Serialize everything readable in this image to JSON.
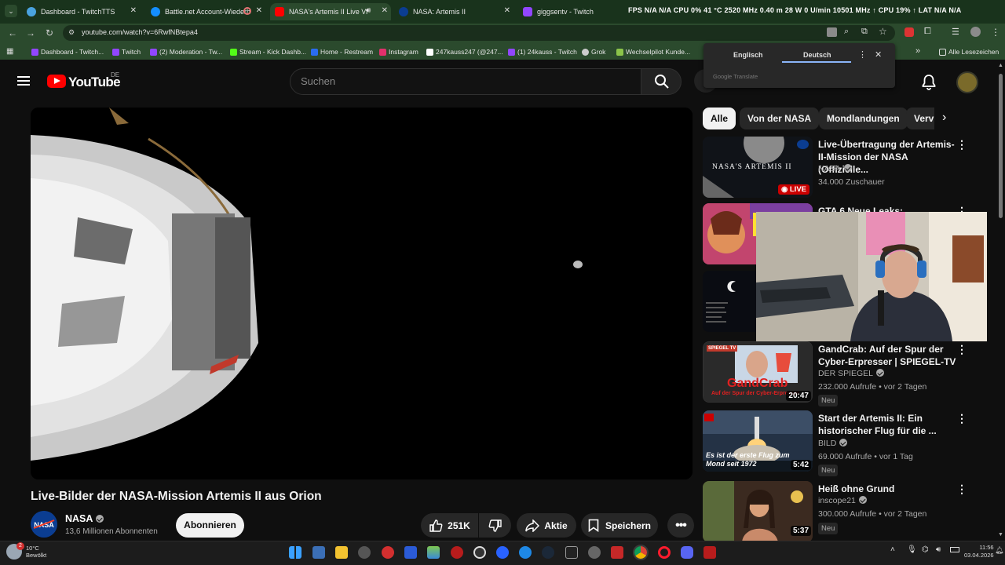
{
  "browser": {
    "tabs": [
      {
        "title": "Dashboard - TwitchTTS",
        "active": false,
        "icon": "globe-icon"
      },
      {
        "title": "Battle.net Account-Wiederh",
        "active": false,
        "icon": "battlenet-icon"
      },
      {
        "title": "NASA's Artemis II Live View",
        "active": true,
        "icon": "youtube-icon"
      },
      {
        "title": "NASA: Artemis II",
        "active": false,
        "icon": "nasa-icon"
      },
      {
        "title": "giggsentv - Twitch",
        "active": false,
        "icon": "twitch-icon"
      }
    ],
    "overlay_stats": "FPS N/A N/A CPU 0% 41 °C 2520 MHz 0.40 m 28 W 0 U/min 10501 MHz ↑ CPU 19% ↑ LAT N/A N/A",
    "url": "youtube.com/watch?v=6RwfNBtepa4",
    "bookmarks": [
      {
        "label": "Dashboard - Twitch...",
        "color": "#9146ff"
      },
      {
        "label": "Twitch",
        "color": "#9146ff"
      },
      {
        "label": "(2) Moderation - Tw...",
        "color": "#9146ff"
      },
      {
        "label": "Stream - Kick Dashb...",
        "color": "#53fc18"
      },
      {
        "label": "Home - Restream",
        "color": "#2a6cf0"
      },
      {
        "label": "Instagram",
        "color": "#e1306c"
      },
      {
        "label": "247kauss247 (@247...",
        "color": "#111111"
      },
      {
        "label": "(1) 24kauss - Twitch",
        "color": "#9146ff"
      },
      {
        "label": "Grok",
        "color": "#222222"
      },
      {
        "label": "Wechselpilot Kunde...",
        "color": "#8bc34a"
      }
    ],
    "all_bookmarks": "Alle Lesezeichen"
  },
  "translate_popup": {
    "lang_source": "Englisch",
    "lang_target": "Deutsch",
    "brand": "Google Translate"
  },
  "youtube": {
    "logo_text": "YouTube",
    "country": "DE",
    "search_placeholder": "Suchen",
    "video": {
      "title": "Live-Bilder der NASA-Mission Artemis II aus Orion",
      "channel": "NASA",
      "subscribers": "13,6 Millionen Abonnenten",
      "subscribe_label": "Abonnieren",
      "likes": "251K",
      "share_label": "Aktie",
      "save_label": "Speichern"
    },
    "chips": [
      "Alle",
      "Von der NASA",
      "Mondlandungen",
      "Verv"
    ],
    "recommendations": [
      {
        "title": "Live-Übertragung der Artemis-II-Mission der NASA (Offizielle...",
        "channel": "NASA",
        "verified": true,
        "meta": "34.000 Zuschauer",
        "badge": "LIVE",
        "thumb_text": "NASA'S ARTEMIS II"
      },
      {
        "title": "GTA 6 Neue Leaks:",
        "channel": "",
        "verified": false,
        "meta": "",
        "badge": ""
      },
      {
        "title": "GandCrab: Auf der Spur der Cyber-Erpresser | SPIEGEL-TV",
        "channel": "DER SPIEGEL",
        "verified": true,
        "meta": "232.000 Aufrufe • vor 2 Tagen",
        "new": "Neu",
        "duration": "20:47",
        "thumb_text": "GandCrab",
        "thumb_sub": "Auf der Spur der Cyber-Erpresser",
        "thumb_tag": "SPIEGEL TV"
      },
      {
        "title": "Start der Artemis II: Ein historischer Flug für die ...",
        "channel": "BILD",
        "verified": true,
        "meta": "69.000 Aufrufe • vor 1 Tag",
        "new": "Neu",
        "duration": "5:42",
        "thumb_text": "Es ist der erste Flug zum Mond seit 1972"
      },
      {
        "title": "Heiß ohne Grund",
        "channel": "inscope21",
        "verified": true,
        "meta": "300.000 Aufrufe • vor 2 Tagen",
        "new": "Neu",
        "duration": "5:37"
      }
    ]
  },
  "taskbar": {
    "weather_temp": "10°C",
    "weather_desc": "Bewölkt",
    "notification_count": "2",
    "time": "11:56",
    "date": "03.04.2026"
  }
}
